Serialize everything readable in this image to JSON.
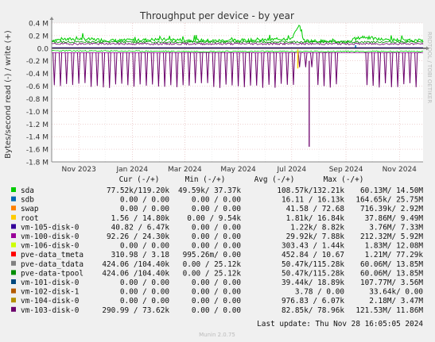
{
  "chart_data": {
    "type": "line",
    "title": "Throughput per device - by year",
    "ylabel": "Bytes/second read (-) / write (+)",
    "watermark": "RRDTOOL / TOBI OETIKER",
    "ylim": [
      -1.8,
      0.4
    ],
    "y_unit": "M",
    "y_ticks": [
      0.4,
      0.2,
      0.0,
      -0.2,
      -0.4,
      -0.6,
      -0.8,
      -1.0,
      -1.2,
      -1.4,
      -1.6,
      -1.8
    ],
    "y_tick_labels": [
      "0.4 M",
      "0.2 M",
      "0.0",
      "-0.2 M",
      "-0.4 M",
      "-0.6 M",
      "-0.8 M",
      "-1.0 M",
      "-1.2 M",
      "-1.4 M",
      "-1.6 M",
      "-1.8 M"
    ],
    "x_ticks": [
      "Nov 2023",
      "Jan 2024",
      "Mar 2024",
      "May 2024",
      "Jul 2024",
      "Sep 2024",
      "Nov 2024"
    ],
    "x_start": "2023-10-01",
    "x_end": "2024-11-28",
    "grid": true,
    "columns": [
      "Cur (-/+)",
      "Min (-/+)",
      "Avg (-/+)",
      "Max (-/+)"
    ],
    "series": [
      {
        "name": "sda",
        "color": "#00cc00",
        "cur": "77.52k/119.20k",
        "min": "49.59k/ 37.37k",
        "avg": "108.57k/132.21k",
        "max": "60.13M/ 14.50M"
      },
      {
        "name": "sdb",
        "color": "#0066b3",
        "cur": "0.00 /  0.00",
        "min": "0.00 /  0.00",
        "avg": "16.11 / 16.13k",
        "max": "164.65k/ 25.75M"
      },
      {
        "name": "swap",
        "color": "#ff8000",
        "cur": "0.00 /  0.00",
        "min": "0.00 /  0.00",
        "avg": "41.58 / 72.68",
        "max": "716.39k/  2.92M"
      },
      {
        "name": "root",
        "color": "#ffcc00",
        "cur": "1.56 / 14.80k",
        "min": "0.00 /  9.54k",
        "avg": "1.81k/ 16.84k",
        "max": "37.86M/  9.49M"
      },
      {
        "name": "vm-105-disk-0",
        "color": "#330099",
        "cur": "40.82 /  6.47k",
        "min": "0.00 /  0.00",
        "avg": "1.22k/  8.82k",
        "max": "3.76M/  7.33M"
      },
      {
        "name": "vm-100-disk-0",
        "color": "#990099",
        "cur": "92.26 / 24.30k",
        "min": "0.00 /  0.00",
        "avg": "29.92k/  7.88k",
        "max": "212.32M/  5.92M"
      },
      {
        "name": "vm-106-disk-0",
        "color": "#ccff00",
        "cur": "0.00 /  0.00",
        "min": "0.00 /  0.00",
        "avg": "303.43 /  1.44k",
        "max": "1.83M/ 12.08M"
      },
      {
        "name": "pve-data_tmeta",
        "color": "#ff0000",
        "cur": "310.98 /  3.18",
        "min": "995.26m/  0.00",
        "avg": "452.84 / 10.67",
        "max": "1.21M/ 77.29k"
      },
      {
        "name": "pve-data_tdata",
        "color": "#808080",
        "cur": "424.06 /104.40k",
        "min": "0.00 / 25.12k",
        "avg": "50.47k/115.28k",
        "max": "60.06M/ 13.85M"
      },
      {
        "name": "pve-data-tpool",
        "color": "#008f00",
        "cur": "424.06 /104.40k",
        "min": "0.00 / 25.12k",
        "avg": "50.47k/115.28k",
        "max": "60.06M/ 13.85M"
      },
      {
        "name": "vm-101-disk-0",
        "color": "#00487d",
        "cur": "0.00 /  0.00",
        "min": "0.00 /  0.00",
        "avg": "39.44k/ 18.89k",
        "max": "107.77M/  3.56M"
      },
      {
        "name": "vm-102-disk-1",
        "color": "#b35a00",
        "cur": "0.00 /  0.00",
        "min": "0.00 /  0.00",
        "avg": "3.78 /  0.00",
        "max": "33.64k/  0.00"
      },
      {
        "name": "vm-104-disk-0",
        "color": "#b38f00",
        "cur": "0.00 /  0.00",
        "min": "0.00 /  0.00",
        "avg": "976.83 /  6.07k",
        "max": "2.18M/  3.47M"
      },
      {
        "name": "vm-103-disk-0",
        "color": "#6b006b",
        "cur": "290.99 / 73.62k",
        "min": "0.00 /  0.00",
        "avg": "82.85k/ 78.96k",
        "max": "121.53M/ 11.86M"
      }
    ],
    "shapes": {
      "sda_write": [
        [
          "2023-10-01",
          0.13
        ],
        [
          "2023-11-01",
          0.15
        ],
        [
          "2023-12-15",
          0.12
        ],
        [
          "2024-02-01",
          0.14
        ],
        [
          "2024-04-01",
          0.12
        ],
        [
          "2024-06-01",
          0.13
        ],
        [
          "2024-07-01",
          0.16
        ],
        [
          "2024-07-10",
          0.36
        ],
        [
          "2024-07-15",
          0.12
        ],
        [
          "2024-08-10",
          0.11
        ],
        [
          "2024-09-01",
          0.1
        ],
        [
          "2024-09-20",
          0.18
        ],
        [
          "2024-10-10",
          0.14
        ],
        [
          "2024-11-28",
          0.12
        ]
      ],
      "sda_read": [
        [
          "2023-10-01",
          -0.04
        ],
        [
          "2024-03-01",
          -0.05
        ],
        [
          "2024-08-01",
          -0.05
        ],
        [
          "2024-11-28",
          -0.05
        ]
      ],
      "vm103_read_spikes": [
        [
          "2023-10-15",
          -0.6
        ],
        [
          "2023-11-15",
          -0.62
        ],
        [
          "2023-12-20",
          -0.55
        ],
        [
          "2024-02-05",
          -0.6
        ],
        [
          "2024-04-10",
          -0.58
        ],
        [
          "2024-06-01",
          -0.55
        ],
        [
          "2024-07-10",
          -0.3
        ],
        [
          "2024-07-21",
          -1.56
        ],
        [
          "2024-08-15",
          -0.6
        ],
        [
          "2024-09-05",
          -0.5
        ],
        [
          "2024-10-15",
          -0.55
        ],
        [
          "2024-11-10",
          -0.58
        ]
      ],
      "vm100_read": [
        [
          "2023-10-01",
          -0.07
        ],
        [
          "2024-11-28",
          -0.07
        ]
      ]
    }
  },
  "footer": {
    "last_update": "Last update: Thu Nov 28 16:05:05 2024",
    "version": "Munin 2.0.75"
  }
}
